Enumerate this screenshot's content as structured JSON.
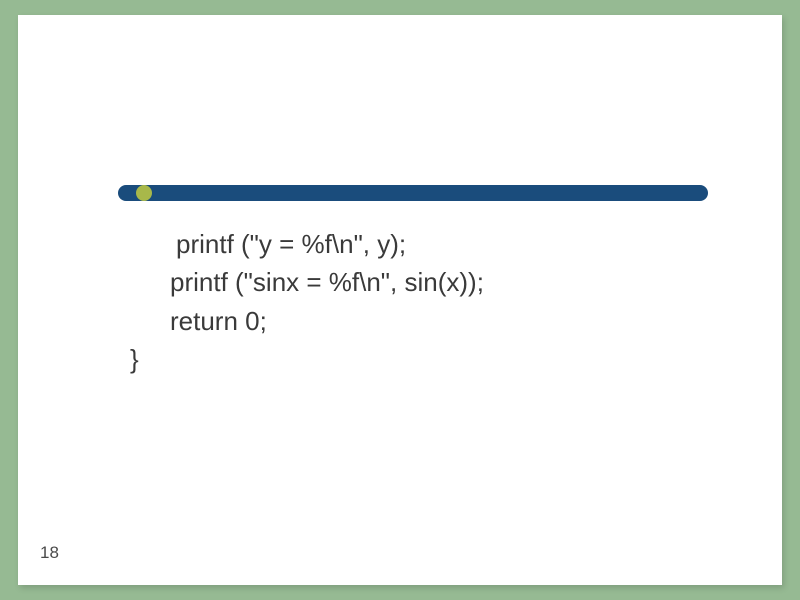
{
  "slide": {
    "code": {
      "line1": "printf (\"y = %f\\n\", y);",
      "line2": "printf (\"sinx = %f\\n\", sin(x));",
      "line3": "return 0;",
      "line4": "}"
    },
    "page_number": "18"
  }
}
